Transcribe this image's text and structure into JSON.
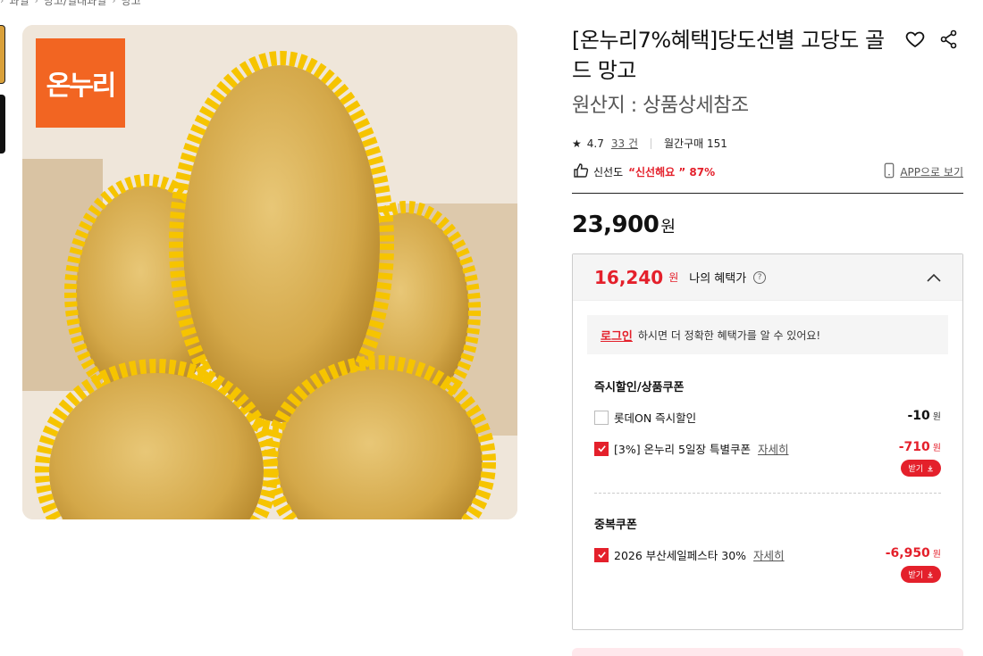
{
  "breadcrumb": [
    "과일",
    "망고/열대과일",
    "망고"
  ],
  "product": {
    "title": "[온누리7%혜택]당도선별 고당도 골드 망고",
    "origin": "원산지 : 상품상세참조",
    "rating": "4.7",
    "review_count": "33 건",
    "monthly_purchase": "월간구매 151",
    "freshness_label": "신선도",
    "freshness_value": "“신선해요 ” 87%",
    "app_link": "APP으로 보기",
    "price": "23,900",
    "price_unit": "원",
    "brand_logo_text": "온누리"
  },
  "benefit": {
    "price": "16,240",
    "unit": "원",
    "label": "나의 혜택가",
    "login_link": "로그인",
    "login_message": "하시면 더 정확한 혜택가를 알 수 있어요!",
    "section1_title": "즉시할인/상품쿠폰",
    "section2_title": "중복쿠폰",
    "receive_label": "받기",
    "detail_label": "자세히",
    "coupons": [
      {
        "name": "롯데ON 즉시할인",
        "amount": "-10",
        "unit": "원",
        "checked": false
      },
      {
        "name": "[3%] 온누리 5일장 특별쿠폰",
        "amount": "-710",
        "unit": "원",
        "checked": true
      },
      {
        "name": "2026 부산세일페스타 30%",
        "amount": "-6,950",
        "unit": "원",
        "checked": true
      }
    ]
  },
  "colors": {
    "accent": "#e4202b",
    "brand": "#f26522"
  }
}
